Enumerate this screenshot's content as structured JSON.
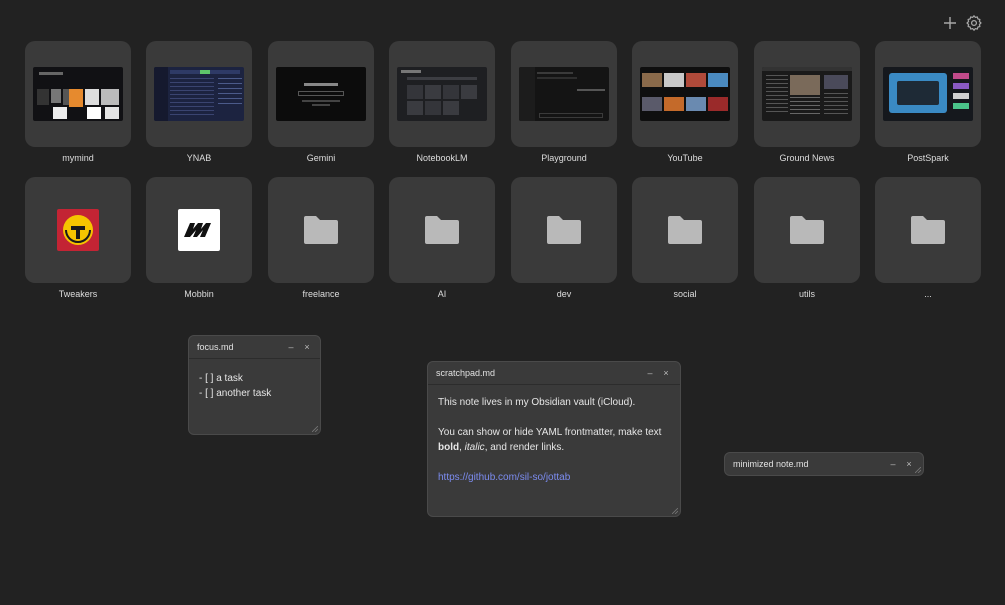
{
  "toolbar": {
    "add_icon": "plus-icon",
    "settings_icon": "gear-icon"
  },
  "shortcuts": [
    {
      "label": "mymind",
      "kind": "thumbnail"
    },
    {
      "label": "YNAB",
      "kind": "thumbnail"
    },
    {
      "label": "Gemini",
      "kind": "thumbnail"
    },
    {
      "label": "NotebookLM",
      "kind": "thumbnail"
    },
    {
      "label": "Playground",
      "kind": "thumbnail"
    },
    {
      "label": "YouTube",
      "kind": "thumbnail"
    },
    {
      "label": "Ground News",
      "kind": "thumbnail"
    },
    {
      "label": "PostSpark",
      "kind": "thumbnail"
    },
    {
      "label": "Tweakers",
      "kind": "app-icon"
    },
    {
      "label": "Mobbin",
      "kind": "app-icon"
    },
    {
      "label": "freelance",
      "kind": "folder"
    },
    {
      "label": "AI",
      "kind": "folder"
    },
    {
      "label": "dev",
      "kind": "folder"
    },
    {
      "label": "social",
      "kind": "folder"
    },
    {
      "label": "utils",
      "kind": "folder"
    },
    {
      "label": "...",
      "kind": "folder"
    }
  ],
  "notes": {
    "focus": {
      "title": "focus.md",
      "lines": [
        "- [ ] a task",
        "- [ ] another task"
      ]
    },
    "scratchpad": {
      "title": "scratchpad.md",
      "line1": "This note lives in my Obsidian vault (iCloud).",
      "line2": "You can show or hide YAML frontmatter, make text",
      "bold": "bold",
      "comma1": ", ",
      "italic": "italic",
      "line3_rest": ", and render links.",
      "link": "https://github.com/sil-so/jottab"
    },
    "minimized": {
      "title": "minimized note.md"
    }
  },
  "colors": {
    "background": "#222222",
    "tile": "#3a3a3a",
    "link": "#7c8cf0",
    "folder": "#b9b9b9"
  }
}
